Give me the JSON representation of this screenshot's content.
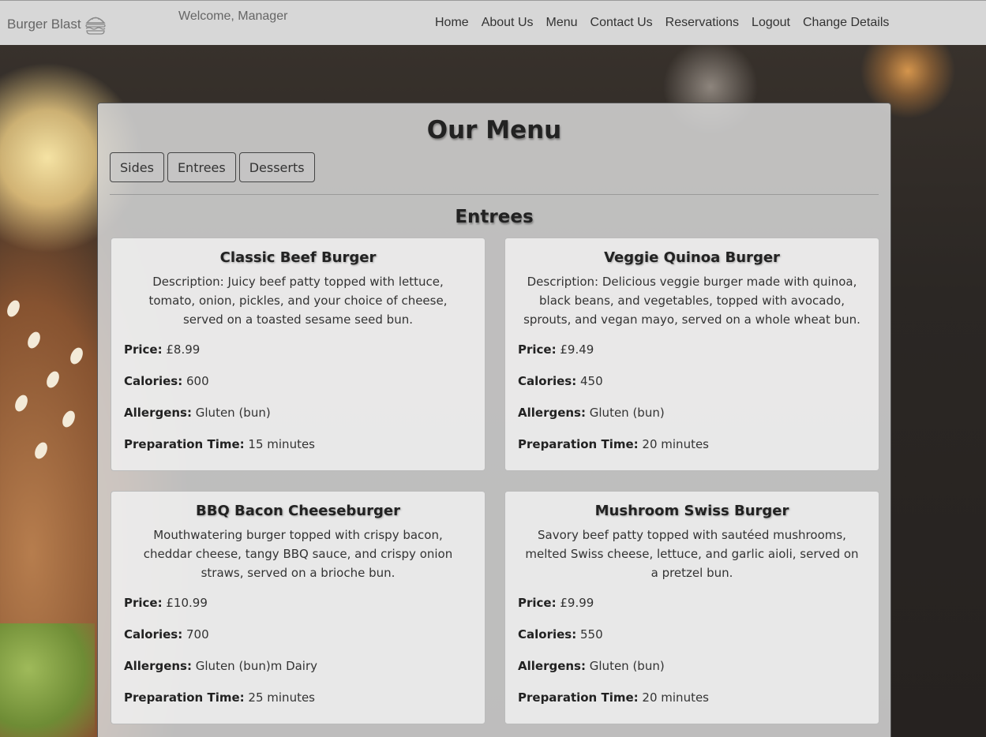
{
  "nav": {
    "brand": "Burger Blast",
    "brand_icon": "burger-icon",
    "welcome": "Welcome, Manager",
    "links": [
      "Home",
      "About Us",
      "Menu",
      "Contact Us",
      "Reservations",
      "Logout",
      "Change Details"
    ]
  },
  "menu": {
    "title": "Our Menu",
    "tabs": [
      "Sides",
      "Entrees",
      "Desserts"
    ],
    "section_title": "Entrees",
    "labels": {
      "price": "Price:",
      "calories": "Calories:",
      "allergens": "Allergens:",
      "prep": "Preparation Time:"
    },
    "items": [
      {
        "name": "Classic Beef Burger",
        "description": "Description: Juicy beef patty topped with lettuce, tomato, onion, pickles, and your choice of cheese, served on a toasted sesame seed bun.",
        "price": "£8.99",
        "calories": "600",
        "allergens": "Gluten (bun)",
        "prep_time": "15 minutes"
      },
      {
        "name": "Veggie Quinoa Burger",
        "description": "Description: Delicious veggie burger made with quinoa, black beans, and vegetables, topped with avocado, sprouts, and vegan mayo, served on a whole wheat bun.",
        "price": "£9.49",
        "calories": "450",
        "allergens": "Gluten (bun)",
        "prep_time": "20 minutes"
      },
      {
        "name": "BBQ Bacon Cheeseburger",
        "description": "Mouthwatering burger topped with crispy bacon, cheddar cheese, tangy BBQ sauce, and crispy onion straws, served on a brioche bun.",
        "price": "£10.99",
        "calories": "700",
        "allergens": "Gluten (bun)m Dairy",
        "prep_time": "25 minutes"
      },
      {
        "name": "Mushroom Swiss Burger",
        "description": "Savory beef patty topped with sautéed mushrooms, melted Swiss cheese, lettuce, and garlic aioli, served on a pretzel bun.",
        "price": "£9.99",
        "calories": "550",
        "allergens": "Gluten (bun)",
        "prep_time": "20 minutes"
      }
    ]
  }
}
